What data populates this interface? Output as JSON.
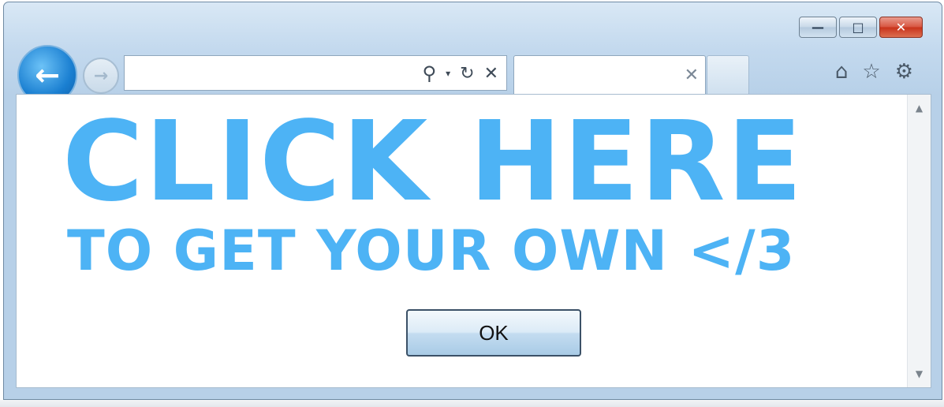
{
  "window": {
    "caption": {
      "minimize_glyph": "—",
      "maximize_glyph": "□",
      "close_glyph": "✕"
    }
  },
  "nav": {
    "back_glyph": "←",
    "forward_glyph": "→"
  },
  "address": {
    "search_glyph": "⚲",
    "dropdown_glyph": "▾",
    "refresh_glyph": "↻",
    "stop_glyph": "✕"
  },
  "tab": {
    "close_glyph": "✕"
  },
  "toolbar": {
    "home_glyph": "⌂",
    "favorites_glyph": "☆",
    "tools_glyph": "⚙"
  },
  "main": {
    "headline": "CLICK HERE",
    "subline": "TO GET YOUR OWN </3",
    "ok_label": "OK"
  },
  "colors": {
    "accent_text": "#4db3f5",
    "back_button": "#1a7fd1"
  },
  "icons": [
    "back-icon",
    "forward-icon",
    "search-icon",
    "refresh-icon",
    "stop-icon",
    "home-icon",
    "star-icon",
    "gear-icon"
  ]
}
